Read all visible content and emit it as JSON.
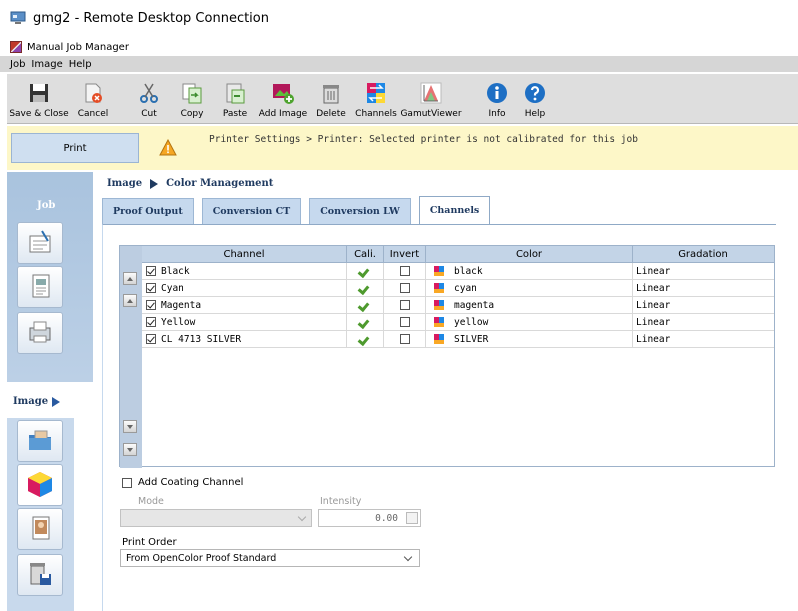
{
  "window": {
    "title": "gmg2 - Remote Desktop Connection"
  },
  "app": {
    "title": "Manual Job Manager"
  },
  "menu": [
    "Job",
    "Image",
    "Help"
  ],
  "toolbar": [
    {
      "label": "Save & Close",
      "icon": "save-icon"
    },
    {
      "label": "Cancel",
      "icon": "cancel-icon"
    },
    {
      "label": "Cut",
      "icon": "cut-icon"
    },
    {
      "label": "Copy",
      "icon": "copy-icon"
    },
    {
      "label": "Paste",
      "icon": "paste-icon"
    },
    {
      "label": "Add Image",
      "icon": "add-image-icon"
    },
    {
      "label": "Delete",
      "icon": "delete-icon"
    },
    {
      "label": "Channels",
      "icon": "channels-icon"
    },
    {
      "label": "GamutViewer",
      "icon": "gamut-viewer-icon"
    },
    {
      "label": "Info",
      "icon": "info-icon"
    },
    {
      "label": "Help",
      "icon": "help-icon"
    }
  ],
  "printbar": {
    "button": "Print",
    "warning": "Printer Settings > Printer: Selected printer is not calibrated for this job"
  },
  "nav": {
    "job": "Job",
    "image": "Image"
  },
  "breadcrumb": {
    "parent": "Image",
    "current": "Color Management"
  },
  "tabs": [
    "Proof Output",
    "Conversion CT",
    "Conversion LW",
    "Channels"
  ],
  "grid": {
    "headers": {
      "channel": "Channel",
      "cali": "Cali.",
      "invert": "Invert",
      "color": "Color",
      "gradation": "Gradation"
    },
    "rows": [
      {
        "channel": "Black",
        "checked": true,
        "calibrated": true,
        "invert": false,
        "color": "black",
        "gradation": "Linear"
      },
      {
        "channel": "Cyan",
        "checked": true,
        "calibrated": true,
        "invert": false,
        "color": "cyan",
        "gradation": "Linear"
      },
      {
        "channel": "Magenta",
        "checked": true,
        "calibrated": true,
        "invert": false,
        "color": "magenta",
        "gradation": "Linear"
      },
      {
        "channel": "Yellow",
        "checked": true,
        "calibrated": true,
        "invert": false,
        "color": "yellow",
        "gradation": "Linear"
      },
      {
        "channel": "CL 4713 SILVER",
        "checked": true,
        "calibrated": true,
        "invert": false,
        "color": "SILVER",
        "gradation": "Linear"
      }
    ]
  },
  "coating": {
    "label": "Add Coating Channel",
    "mode_label": "Mode",
    "intensity_label": "Intensity",
    "intensity_value": "0.00"
  },
  "print_order": {
    "label": "Print Order",
    "value": "From OpenColor Proof Standard"
  }
}
